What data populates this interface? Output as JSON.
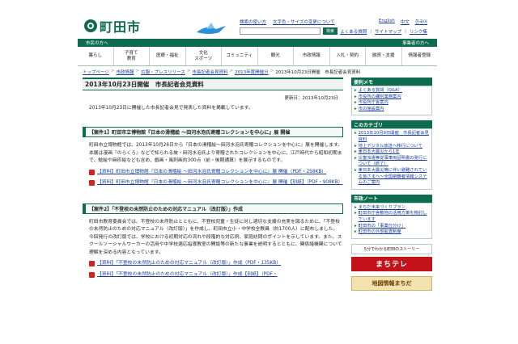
{
  "header": {
    "logo_text": "町田市",
    "util_links_top": [
      "検索の使い方",
      "文字色・サイズの変更について"
    ],
    "search_placeholder": "",
    "search_button": "検索",
    "languages": [
      "English",
      "中文",
      "한국어"
    ],
    "util_links_right": [
      "よくある質問",
      "サイトマップ",
      "リンク集"
    ]
  },
  "greenbar": {
    "left": "市民の方へ",
    "right": "事業者の方へ"
  },
  "gnav": [
    "暮らし",
    "子育て\n教育",
    "医療・福祉",
    "文化\nスポーツ",
    "コミュニティ",
    "観光",
    "市政情報",
    "入札・契約",
    "融資・支援",
    "情報者登録"
  ],
  "breadcrumb": [
    "トップページ",
    "市政情報",
    "広報・プレスリリース",
    "市長記者会見資料",
    "2013年度開催分",
    "2013年10月23日開催　市長記者会見資料"
  ],
  "main": {
    "title": "2013年10月23日開催　市長記者会見資料",
    "updated": "更新日：2013年10月23日",
    "intro": "2013年10月23日に開催した市長記者会見で発表した資料を掲載しています。",
    "sections": [
      {
        "heading": "【案件1】町田市立博物館『日本の滑稽絵 ～田河水泡氏寄贈コレクションを中心に』展 開催",
        "paragraphs": [
          "町田市立博物館では、2013年10月26日から『日本の滑稽絵～田河水泡氏寄贈コレクションを中心に』展を開催します。",
          "本展は漫画『のらくろ』などで知られる故・田河水泡氏より寄贈されたコレクションを中心に、江戸時代から昭和初期まで、鯰絵や麻疹絵なども含め、戯画・風刺画約300点（前・後期通算）を展示するものです。"
        ],
        "links": [
          "【資料】町田市立博物館『日本の滑稽絵 ～田河水泡氏寄贈コレクションを中心に』展 開催（PDF・258KB）",
          "【資料】町田市立博物館『日本の滑稽絵 ～田河水泡氏寄贈コレクションを中心に』展 開催【別紙】（PDF・908KB）"
        ]
      },
      {
        "heading": "【案件2】「不登校の未然防止のための対応マニュアル（改訂版）」作成",
        "paragraphs": [
          "町田市教育委員会では、不登校の未然防止とともに、不登校児童・生徒に対し適切な支援の充実を図るために、「不登校の未然防止のための対応マニュアル（改訂版）」を作成し、町田市立小・中学校全教員（約1700人）に配布しました。",
          "今回発行の改訂版では、学校における初期対応の流れや段階的な対応例、家庭訪問のポイントを示しています。また、スクールソーシャルワーカーの活用や中学校適応指導教室の開設等の新たな事業を説明するとともに、関係諸機関について理解を深める内容となっています。"
        ],
        "links": [
          "【資料】「不登校の未然防止のための対応マニュアル（改訂版）」作成（PDF・135KB）",
          "【資料】「不登校の未然防止のための対応マニュアル（改訂版）」作成【別紙】（PDF・"
        ]
      }
    ]
  },
  "sidebar": {
    "memo_title": "便利メモ",
    "memo_items": [
      "よくある質問（Q&A）",
      "市役所の課別業務案内",
      "市役所庁舎案内",
      "市の施設案内"
    ],
    "section_title": "このカテゴリ",
    "section_items": [
      "2013年10月9日開催　市長記者会見資料",
      "地上デジタル放送へ移行について",
      "東日本大震災から1年",
      "災害派遣等従事車両証明書の発行について（終了）",
      "東日本大震災等に伴い避難されている皆さまへ～全国避難者情報システムのご案内"
    ],
    "note_title": "市政ノート",
    "note_items": [
      "まちだ未来づくりプラン",
      "町田市庁舎敷地の活用方策を検討しています",
      "町田市の「事業仕分け」",
      "町田市の外部監査制度"
    ],
    "story": "5分でわかる町田のストーリー",
    "tele_banner": "まちテレ",
    "map_banner": "地図情報まちだ"
  }
}
